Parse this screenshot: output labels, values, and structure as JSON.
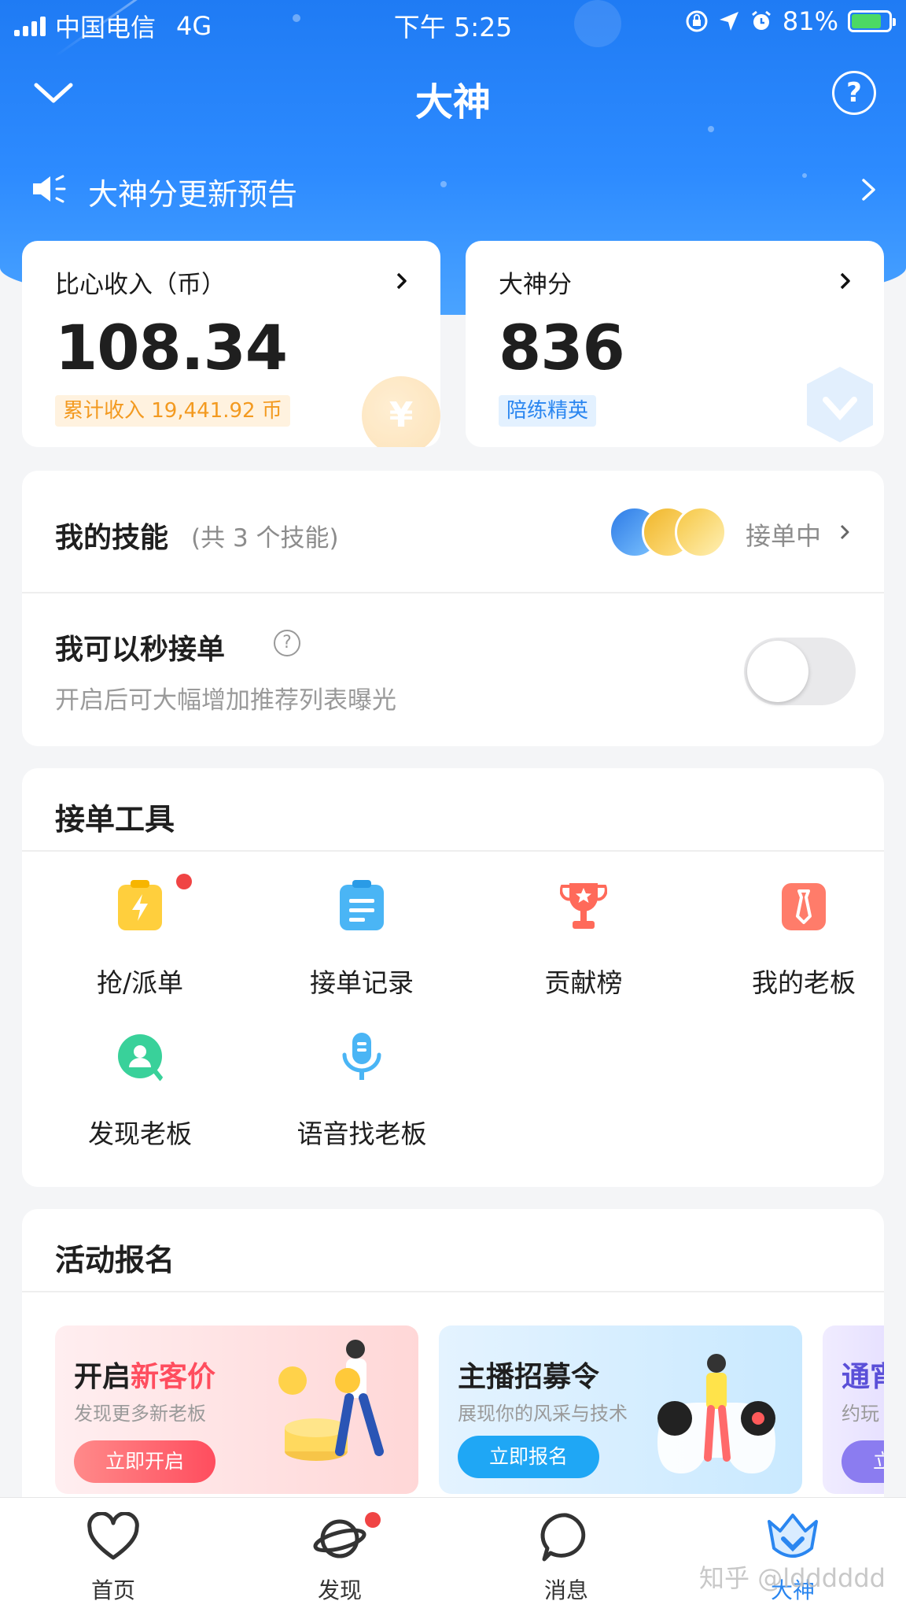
{
  "status_bar": {
    "carrier": "中国电信",
    "network": "4G",
    "time": "下午 5:25",
    "battery": "81%",
    "icons": [
      "signal-icon",
      "lock-rotation-icon",
      "location-icon",
      "alarm-icon",
      "battery-charging-icon"
    ]
  },
  "navbar": {
    "title": "大神",
    "back_icon": "chevron-down-icon",
    "help_icon": "question-circle-icon",
    "help_glyph": "?"
  },
  "announcement": {
    "text": "大神分更新预告",
    "icon": "speaker-icon"
  },
  "stats": {
    "income": {
      "label": "比心收入（币）",
      "value": "108.34",
      "badge": "累计收入 19,441.92 币",
      "deco_glyph": "¥"
    },
    "score": {
      "label": "大神分",
      "value": "836",
      "badge": "陪练精英"
    }
  },
  "skills": {
    "title": "我的技能",
    "count": "(共 3 个技能)",
    "status": "接单中"
  },
  "quick_accept": {
    "title": "我可以秒接单",
    "help_glyph": "?",
    "description": "开启后可大幅增加推荐列表曝光",
    "enabled": false
  },
  "tools": {
    "title": "接单工具",
    "items": [
      {
        "label": "抢/派单",
        "icon": "lightning-clipboard-icon",
        "color": "#ffcf3d",
        "has_dot": true
      },
      {
        "label": "接单记录",
        "icon": "record-list-icon",
        "color": "#4ab5f5",
        "has_dot": false
      },
      {
        "label": "贡献榜",
        "icon": "trophy-icon",
        "color": "#ff6a5a",
        "has_dot": false
      },
      {
        "label": "我的老板",
        "icon": "tie-icon",
        "color": "#ff7c6a",
        "has_dot": false
      },
      {
        "label": "发现老板",
        "icon": "person-search-icon",
        "color": "#39d19a",
        "has_dot": false
      },
      {
        "label": "语音找老板",
        "icon": "microphone-icon",
        "color": "#4ab5f5",
        "has_dot": false
      }
    ]
  },
  "activities": {
    "title": "活动报名",
    "banners": [
      {
        "title_prefix": "开启",
        "title_highlight": "新客价",
        "subtitle": "发现更多新老板",
        "button": "立即开启"
      },
      {
        "title": "主播招募令",
        "subtitle": "展现你的风采与技术",
        "button": "立即报名"
      },
      {
        "title": "通宵",
        "subtitle": "约玩",
        "button": "立"
      }
    ]
  },
  "tabbar": {
    "items": [
      {
        "label": "首页",
        "icon": "heart-icon",
        "active": false
      },
      {
        "label": "发现",
        "icon": "planet-icon",
        "active": false,
        "has_dot": true
      },
      {
        "label": "消息",
        "icon": "chat-bubble-icon",
        "active": false
      },
      {
        "label": "大神",
        "icon": "crown-shield-icon",
        "active": true
      }
    ]
  },
  "watermark": "知乎 @ldddddd",
  "colors": {
    "header_blue": "#1f7bf4",
    "accent_blue": "#2a86f0",
    "income_orange": "#f39a20",
    "dot_red": "#f04444",
    "toggle_off": "#e9e9eb"
  }
}
